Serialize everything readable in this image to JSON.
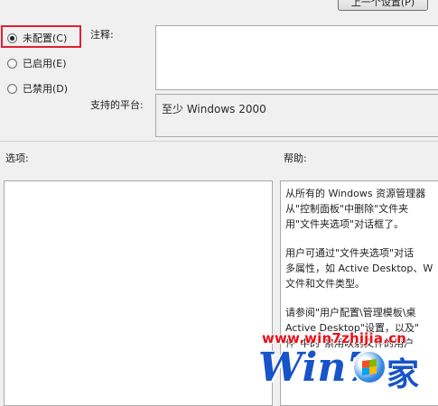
{
  "top_button": {
    "label": "上一个设置(P)"
  },
  "radios": [
    {
      "label": "未配置(C)",
      "selected": true
    },
    {
      "label": "已启用(E)",
      "selected": false
    },
    {
      "label": "已禁用(D)",
      "selected": false
    }
  ],
  "comment": {
    "label": "注释:",
    "value": ""
  },
  "platform": {
    "label": "支持的平台:",
    "value": "至少 Windows 2000"
  },
  "options": {
    "label": "选项:"
  },
  "help": {
    "label": "帮助:",
    "paragraphs": [
      "从所有的 Windows 资源管理器\n从\"控制面板\"中删除\"文件夹\n用\"文件夹选项\"对话框了。",
      "用户可通过\"文件夹选项\"对话\n多属性，如 Active Desktop、W\n文件和文件类型。",
      "请参阅\"用户配置\\管理模板\\桌\nActive Desktop\"设置，以及\"\n件\"中的\"禁用映射文件的用户"
    ]
  },
  "watermark": {
    "url": "www.win7zhijia.cn",
    "logo_text": "Win7",
    "logo_char": "家"
  },
  "colors": {
    "highlight": "#e02030",
    "watermark_blue": "#1753c9",
    "watermark_red": "#e8101a"
  }
}
